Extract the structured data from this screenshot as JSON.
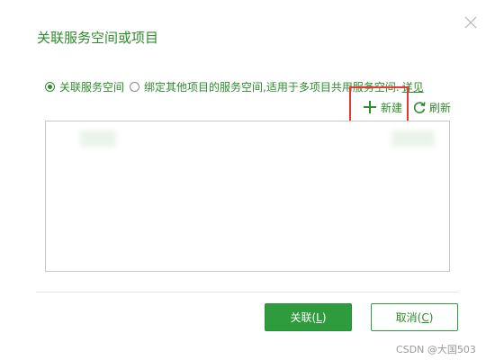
{
  "dialog": {
    "title": "关联服务空间或项目",
    "close_icon": "close-icon"
  },
  "options": {
    "option1": {
      "label": "关联服务空间",
      "checked": true
    },
    "option2": {
      "label": "绑定其他项目的服务空间,适用于多项目共用服务空间.",
      "checked": false
    },
    "detail_link": "详见"
  },
  "toolbar": {
    "new_label": "新建",
    "new_icon": "plus-icon",
    "refresh_label": "刷新",
    "refresh_icon": "refresh-icon"
  },
  "buttons": {
    "confirm_text": "关联",
    "confirm_key": "L",
    "cancel_text": "取消",
    "cancel_key": "C"
  },
  "watermark": "CSDN @大国503",
  "colors": {
    "accent": "#2e8b2e",
    "primary_button": "#2e9b3c",
    "highlight": "#e53935"
  }
}
